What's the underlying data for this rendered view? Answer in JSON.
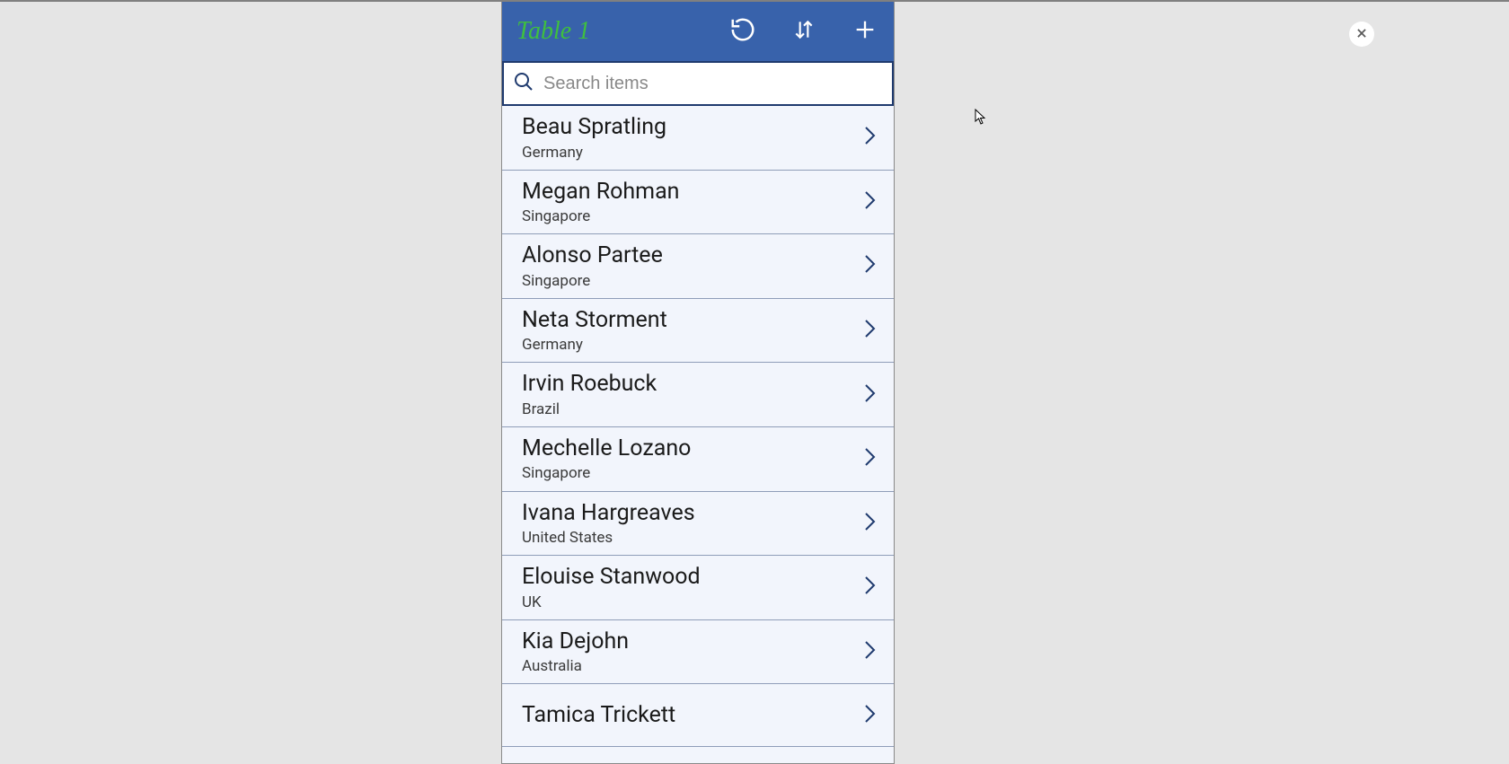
{
  "header": {
    "title": "Table 1"
  },
  "search": {
    "placeholder": "Search items"
  },
  "items": [
    {
      "name": "Beau Spratling",
      "sub": "Germany"
    },
    {
      "name": "Megan Rohman",
      "sub": "Singapore"
    },
    {
      "name": "Alonso Partee",
      "sub": "Singapore"
    },
    {
      "name": "Neta Storment",
      "sub": "Germany"
    },
    {
      "name": "Irvin Roebuck",
      "sub": "Brazil"
    },
    {
      "name": "Mechelle Lozano",
      "sub": "Singapore"
    },
    {
      "name": "Ivana Hargreaves",
      "sub": "United States"
    },
    {
      "name": "Elouise Stanwood",
      "sub": "UK"
    },
    {
      "name": "Kia Dejohn",
      "sub": "Australia"
    },
    {
      "name": "Tamica Trickett",
      "sub": ""
    }
  ]
}
